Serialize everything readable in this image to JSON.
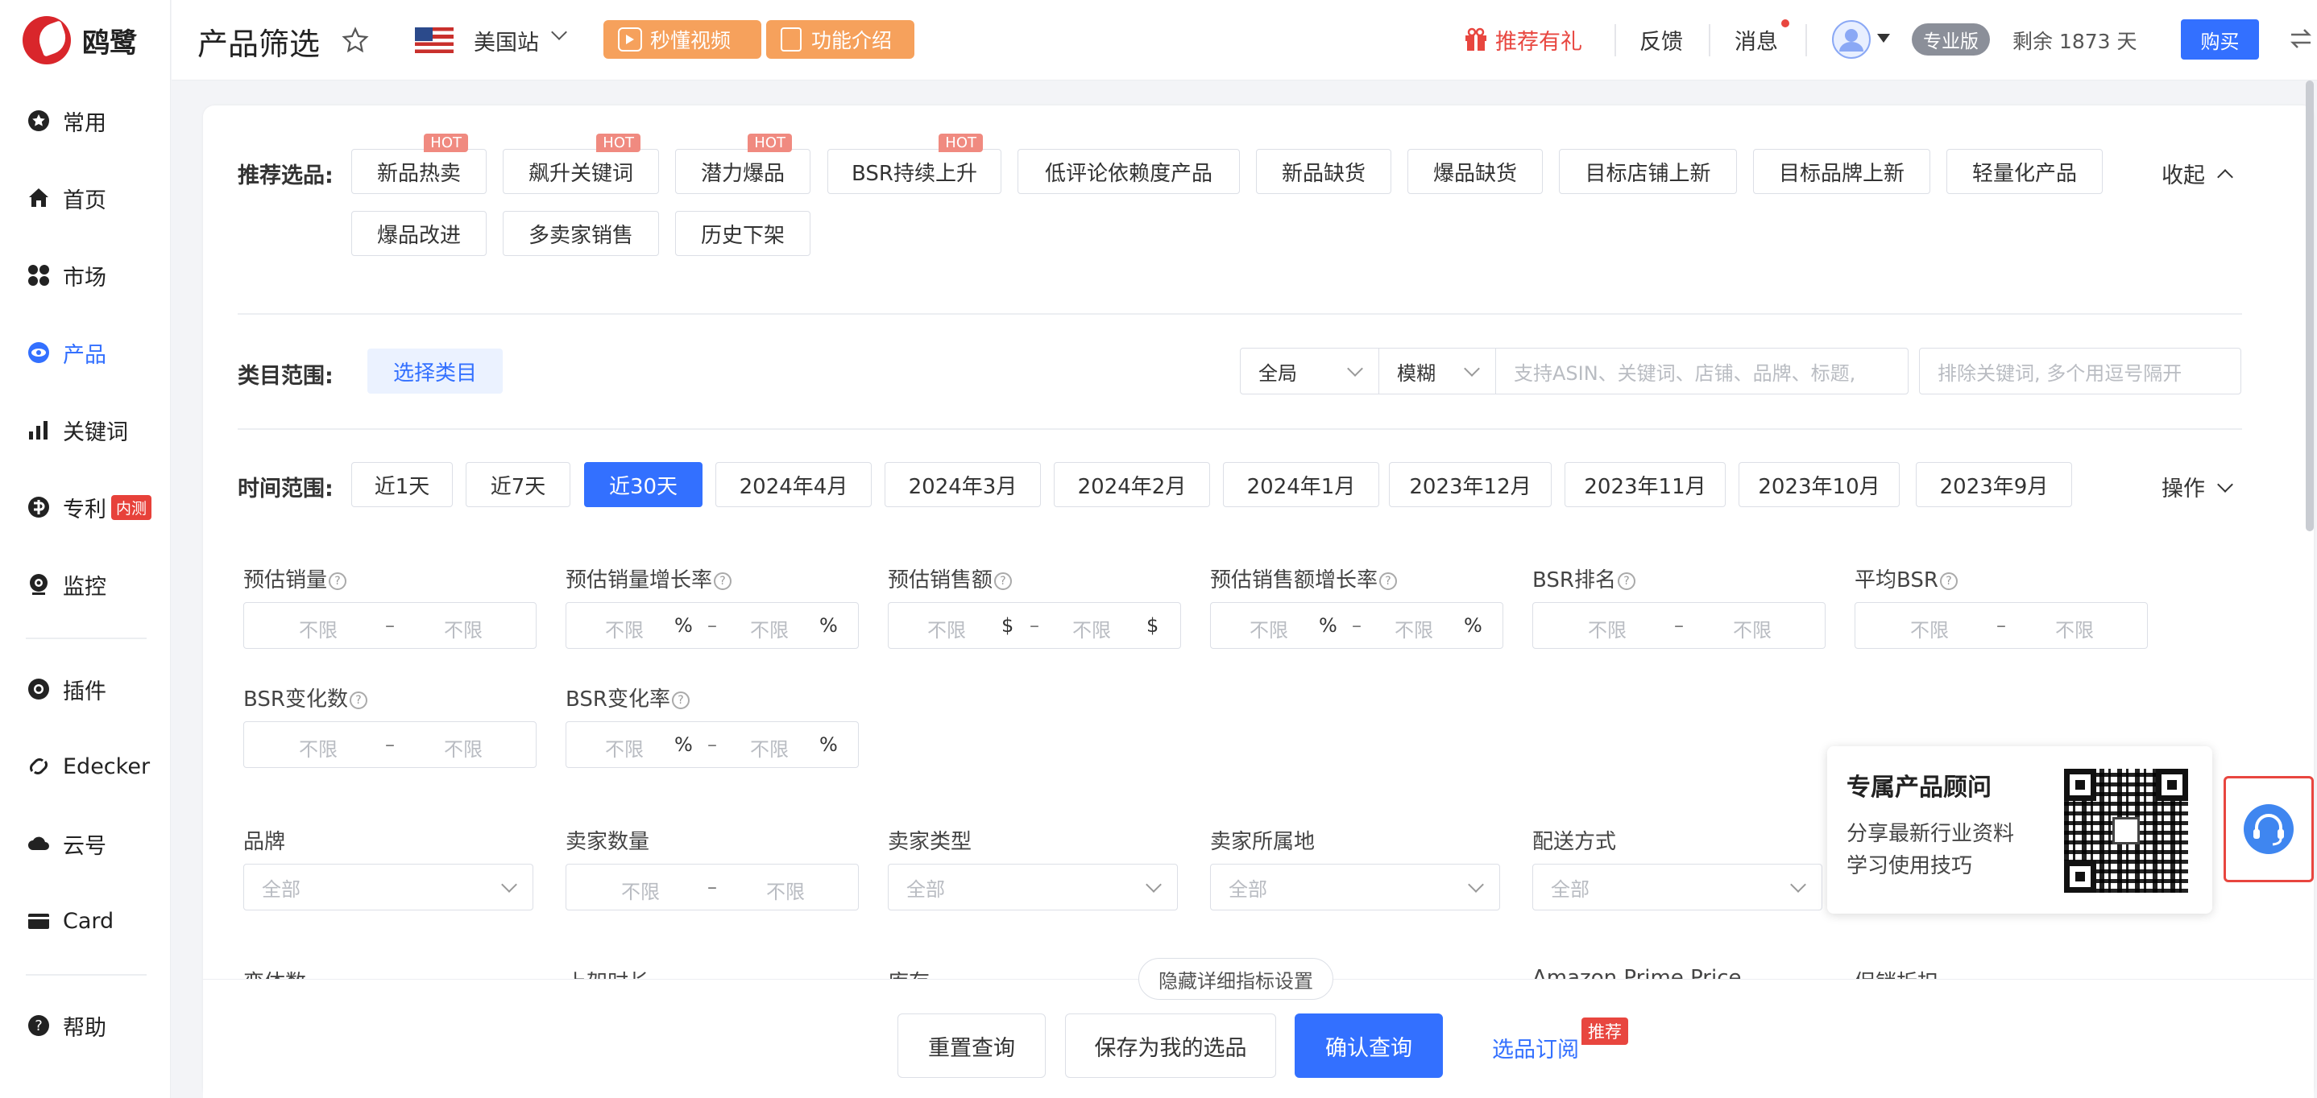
{
  "app": {
    "name": "鸥鹭"
  },
  "sidebar": {
    "items": [
      {
        "label": "常用",
        "icon": "star-circle-icon"
      },
      {
        "label": "首页",
        "icon": "home-icon"
      },
      {
        "label": "市场",
        "icon": "grid-icon"
      },
      {
        "label": "产品",
        "icon": "eye-icon"
      },
      {
        "label": "关键词",
        "icon": "bar-chart-icon"
      },
      {
        "label": "专利",
        "icon": "patent-icon",
        "badge": "内测"
      },
      {
        "label": "监控",
        "icon": "camera-icon"
      },
      {
        "label": "插件",
        "icon": "chrome-icon"
      },
      {
        "label": "Edecker",
        "icon": "link-icon"
      },
      {
        "label": "云号",
        "icon": "cloud-icon"
      },
      {
        "label": "Card",
        "icon": "card-icon"
      },
      {
        "label": "帮助",
        "icon": "help-icon"
      }
    ]
  },
  "header": {
    "title": "产品筛选",
    "site": "美国站",
    "video_btn": "秒懂视频",
    "intro_btn": "功能介绍",
    "gift": "推荐有礼",
    "feedback": "反馈",
    "messages": "消息",
    "plan": "专业版",
    "remaining": "剩余 1873 天",
    "buy": "购买"
  },
  "recommend": {
    "label": "推荐选品:",
    "collapse": "收起",
    "hot_label": "HOT",
    "chips": [
      "新品热卖",
      "飙升关键词",
      "潜力爆品",
      "BSR持续上升",
      "低评论依赖度产品",
      "新品缺货",
      "爆品缺货",
      "目标店铺上新",
      "目标品牌上新",
      "轻量化产品",
      "爆品改进",
      "多卖家销售",
      "历史下架"
    ]
  },
  "category": {
    "label": "类目范围:",
    "select": "选择类目",
    "scope": "全局",
    "match": "模糊",
    "search_placeholder": "支持ASIN、关键词、店铺、品牌、标题,",
    "exclude_placeholder": "排除关键词, 多个用逗号隔开"
  },
  "time": {
    "label": "时间范围:",
    "options": [
      "近1天",
      "近7天",
      "近30天",
      "2024年4月",
      "2024年3月",
      "2024年2月",
      "2024年1月",
      "2023年12月",
      "2023年11月",
      "2023年10月",
      "2023年9月"
    ],
    "selected": "近30天",
    "ops": "操作"
  },
  "filters": {
    "unlimited": "不限",
    "dash": "–",
    "all": "全部",
    "fields": [
      "预估销量",
      "预估销量增长率",
      "预估销售额",
      "预估销售额增长率",
      "BSR排名",
      "平均BSR",
      "BSR变化数",
      "BSR变化率"
    ],
    "selects": [
      "品牌",
      "卖家数量",
      "卖家类型",
      "卖家所属地",
      "配送方式"
    ],
    "partial": [
      "变体数",
      "上架时长",
      "库存",
      "Amazon Prime Price",
      "促销折扣"
    ]
  },
  "footer": {
    "hide_detail": "隐藏详细指标设置",
    "reset": "重置查询",
    "save": "保存为我的选品",
    "confirm": "确认查询",
    "subscribe": "选品订阅",
    "subscribe_badge": "推荐"
  },
  "consultant": {
    "title": "专属产品顾问",
    "line1": "分享最新行业资料",
    "line2": "学习使用技巧"
  },
  "colors": {
    "accent": "#3370ff",
    "brand_red": "#d9262b",
    "orange": "#f6a15c"
  }
}
